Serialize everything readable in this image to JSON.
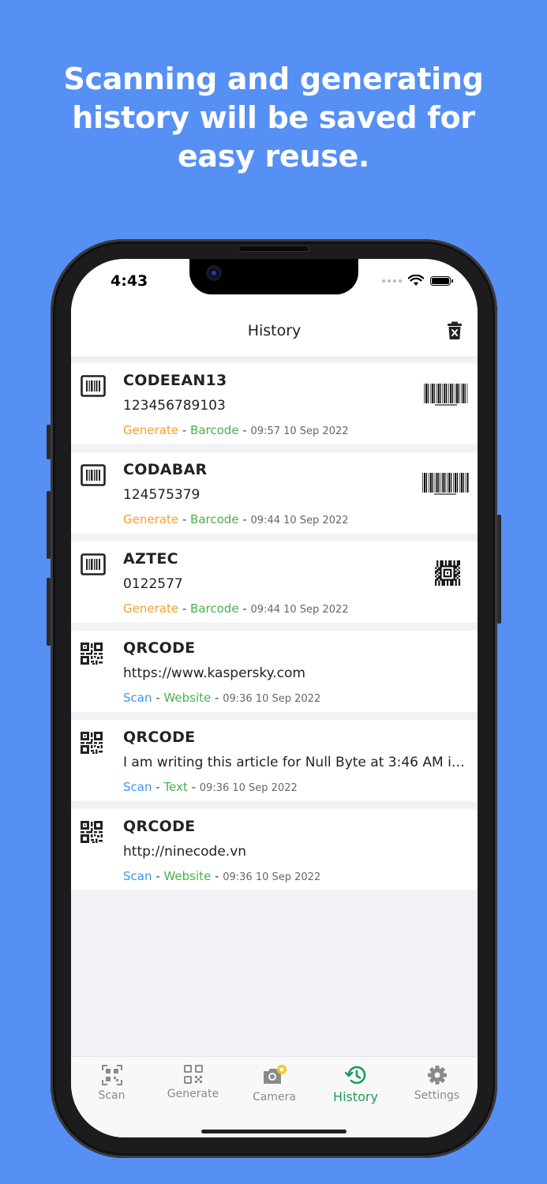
{
  "headline": "Scanning and generating history will be saved for easy reuse.",
  "status_bar": {
    "time": "4:43"
  },
  "nav": {
    "title": "History",
    "delete_icon": "trash-icon"
  },
  "history": [
    {
      "type_icon": "barcode-icon",
      "title": "CODEEAN13",
      "content": "123456789103",
      "action": "Generate",
      "category": "Barcode",
      "datetime": "09:57 10 Sep 2022",
      "preview": "ean13-barcode-preview"
    },
    {
      "type_icon": "barcode-icon",
      "title": "CODABAR",
      "content": "124575379",
      "action": "Generate",
      "category": "Barcode",
      "datetime": "09:44 10 Sep 2022",
      "preview": "codabar-barcode-preview"
    },
    {
      "type_icon": "barcode-icon",
      "title": "AZTEC",
      "content": "0122577",
      "action": "Generate",
      "category": "Barcode",
      "datetime": "09:44 10 Sep 2022",
      "preview": "aztec-code-preview"
    },
    {
      "type_icon": "qrcode-icon",
      "title": "QRCODE",
      "content": "https://www.kaspersky.com",
      "action": "Scan",
      "category": "Website",
      "datetime": "09:36 10 Sep 2022"
    },
    {
      "type_icon": "qrcode-icon",
      "title": "QRCODE",
      "content": "I am writing this article for Null Byte at 3:46 AM in ...",
      "action": "Scan",
      "category": "Text",
      "datetime": "09:36 10 Sep 2022"
    },
    {
      "type_icon": "qrcode-icon",
      "title": "QRCODE",
      "content": "http://ninecode.vn",
      "action": "Scan",
      "category": "Website",
      "datetime": "09:36 10 Sep 2022"
    }
  ],
  "separator": "-",
  "tabs": [
    {
      "label": "Scan",
      "icon": "scan-icon"
    },
    {
      "label": "Generate",
      "icon": "generate-icon"
    },
    {
      "label": "Camera",
      "icon": "camera-icon"
    },
    {
      "label": "History",
      "icon": "history-icon",
      "active": true
    },
    {
      "label": "Settings",
      "icon": "gear-icon"
    }
  ],
  "colors": {
    "background": "#5690F4",
    "generate": "#F2A033",
    "scan": "#3B97E8",
    "category": "#4CAF50",
    "active_tab": "#1E9C5C"
  }
}
